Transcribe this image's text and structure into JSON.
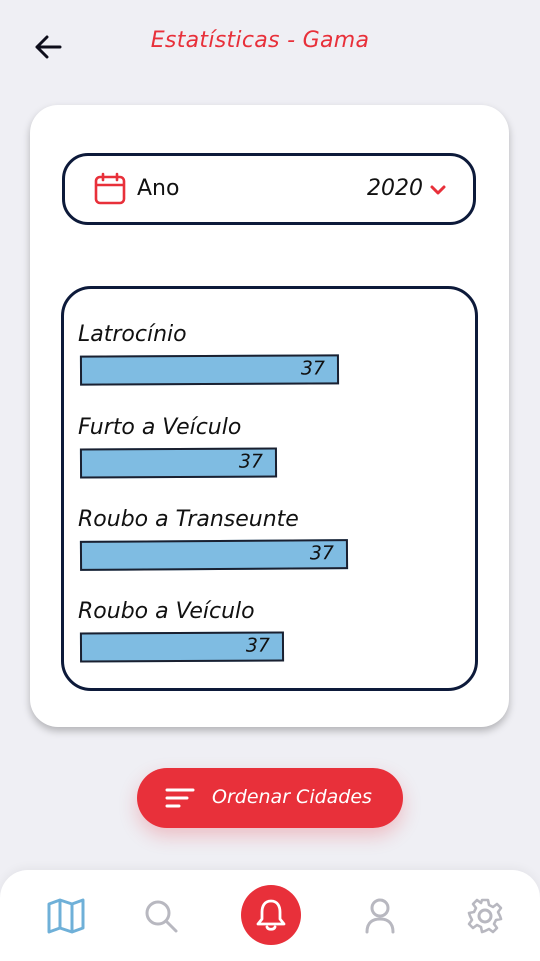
{
  "header": {
    "title": "Estatísticas - Gama",
    "back_icon": "arrow-left-icon"
  },
  "year_filter": {
    "icon": "calendar-icon",
    "label": "Ano",
    "value": "2020",
    "chevron_icon": "chevron-down-icon"
  },
  "stats": [
    {
      "label": "Latrocínio",
      "value": "37"
    },
    {
      "label": "Furto a Veículo",
      "value": "37"
    },
    {
      "label": "Roubo a Transeunte",
      "value": "37"
    },
    {
      "label": "Roubo a Veículo",
      "value": "37"
    }
  ],
  "order_button": {
    "label": "Ordenar Cidades",
    "icon": "sort-icon"
  },
  "bottom_nav": {
    "items": [
      "map-icon",
      "search-icon",
      "bell-icon",
      "user-icon",
      "gear-icon"
    ],
    "active": "map-icon"
  },
  "colors": {
    "accent": "#e8303a",
    "bar": "#7fbce2",
    "outline": "#0d1a3a",
    "nav_active": "#6fb0d8",
    "nav_inactive": "#b8b8c0",
    "background": "#efeff4"
  }
}
